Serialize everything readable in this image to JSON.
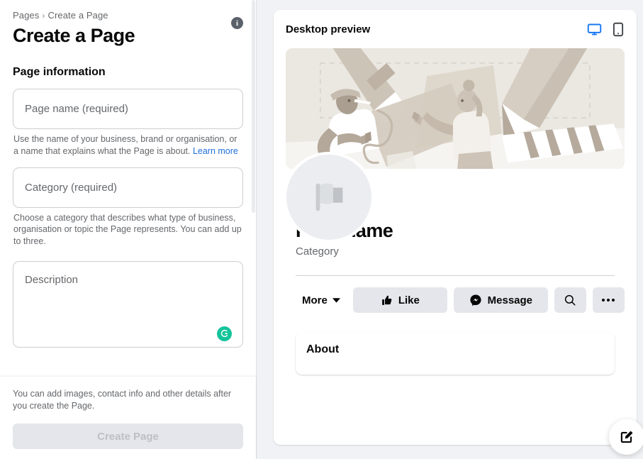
{
  "left": {
    "breadcrumb": {
      "root": "Pages",
      "separator": "›",
      "current": "Create a Page"
    },
    "title": "Create a Page",
    "info_icon": {
      "name": "info-icon",
      "glyph": "i"
    },
    "section_title": "Page information",
    "fields": {
      "page_name": {
        "placeholder": "Page name (required)",
        "value": ""
      },
      "page_name_helper": "Use the name of your business, brand or organisation, or a name that explains what the Page is about. ",
      "page_name_helper_link": "Learn more",
      "category": {
        "placeholder": "Category (required)",
        "value": ""
      },
      "category_helper": "Choose a category that describes what type of business, organisation or topic the Page represents. You can add up to three.",
      "description": {
        "placeholder": "Description",
        "value": ""
      }
    },
    "grammarly_icon": {
      "name": "grammarly-icon",
      "color": "#15c39a",
      "glyph": "G"
    },
    "footer_note": "You can add images, contact info and other details after you create the Page.",
    "create_button": {
      "label": "Create Page",
      "enabled": false
    }
  },
  "preview": {
    "header_title": "Desktop preview",
    "devices": [
      {
        "name": "desktop-preview-toggle",
        "icon": "monitor-icon",
        "active": true,
        "color": "#1877f2"
      },
      {
        "name": "mobile-preview-toggle",
        "icon": "mobile-icon",
        "active": false,
        "color": "#44464a"
      }
    ],
    "cover": {
      "name": "cover-photo-placeholder",
      "bg": "#ebe8e2"
    },
    "avatar": {
      "name": "profile-photo-placeholder",
      "icon": "flag-icon",
      "bg": "#ebedf0"
    },
    "page_name": "Page name",
    "category": "Category",
    "actions": [
      {
        "name": "more-dropdown",
        "label": "More",
        "icon": "chevron-down-icon",
        "style": "text"
      },
      {
        "name": "like-button",
        "label": "Like",
        "icon": "thumbs-up-icon",
        "style": "pill-wide"
      },
      {
        "name": "message-button",
        "label": "Message",
        "icon": "messenger-icon",
        "style": "pill-wide"
      },
      {
        "name": "search-button",
        "label": "",
        "icon": "search-icon",
        "style": "pill-icon"
      },
      {
        "name": "more-options-button",
        "label": "",
        "icon": "ellipsis-icon",
        "style": "pill-icon"
      }
    ],
    "about_card": {
      "title": "About"
    }
  },
  "fab": {
    "name": "compose-button",
    "icon": "compose-icon"
  },
  "colors": {
    "page_background": "#f0f2f5",
    "panel_background": "#ffffff",
    "accent_blue": "#1877f2",
    "link_blue": "#216fdb",
    "muted_text": "#65676b",
    "pill_grey": "#e4e6eb",
    "grammarly_green": "#15c39a"
  }
}
